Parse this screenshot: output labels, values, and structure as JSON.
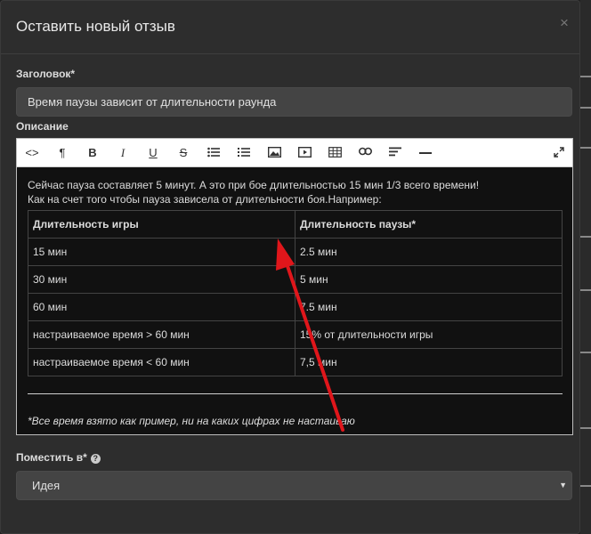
{
  "modal": {
    "title": "Оставить новый отзыв",
    "close_glyph": "×"
  },
  "form": {
    "title_label": "Заголовок*",
    "title_value": "Время паузы зависит от длительности раунда",
    "description_label": "Описание",
    "place_label": "Поместить в*",
    "place_value": "Идея"
  },
  "toolbar": {
    "buttons": [
      "code-view",
      "paragraph",
      "bold",
      "italic",
      "underline",
      "strikethrough",
      "unordered-list",
      "ordered-list",
      "image",
      "video",
      "table",
      "link",
      "align",
      "horizontal-line",
      "fullscreen"
    ]
  },
  "content": {
    "line1": "Сейчас пауза составляет 5 минут. А это при бое длительностью 15 мин 1/3 всего времени!",
    "line2": "Как на счет того чтобы пауза зависела от длительности боя.Например:",
    "table": {
      "headers": [
        "Длительность игры",
        "Длительность паузы*"
      ],
      "rows": [
        [
          "15 мин",
          "2.5 мин"
        ],
        [
          "30 мин",
          "5 мин"
        ],
        [
          "60 мин",
          "7.5 мин"
        ],
        [
          "настраиваемое время > 60 мин",
          "15% от длительности игры"
        ],
        [
          "настраиваемое время < 60 мин",
          "7,5 мин"
        ]
      ]
    },
    "note": "*Все время взято как пример, ни на каких цифрах не настаиваю"
  },
  "colors": {
    "annotation_arrow": "#e0161b",
    "modal_bg": "#2d2d2d",
    "input_bg": "#444444"
  }
}
